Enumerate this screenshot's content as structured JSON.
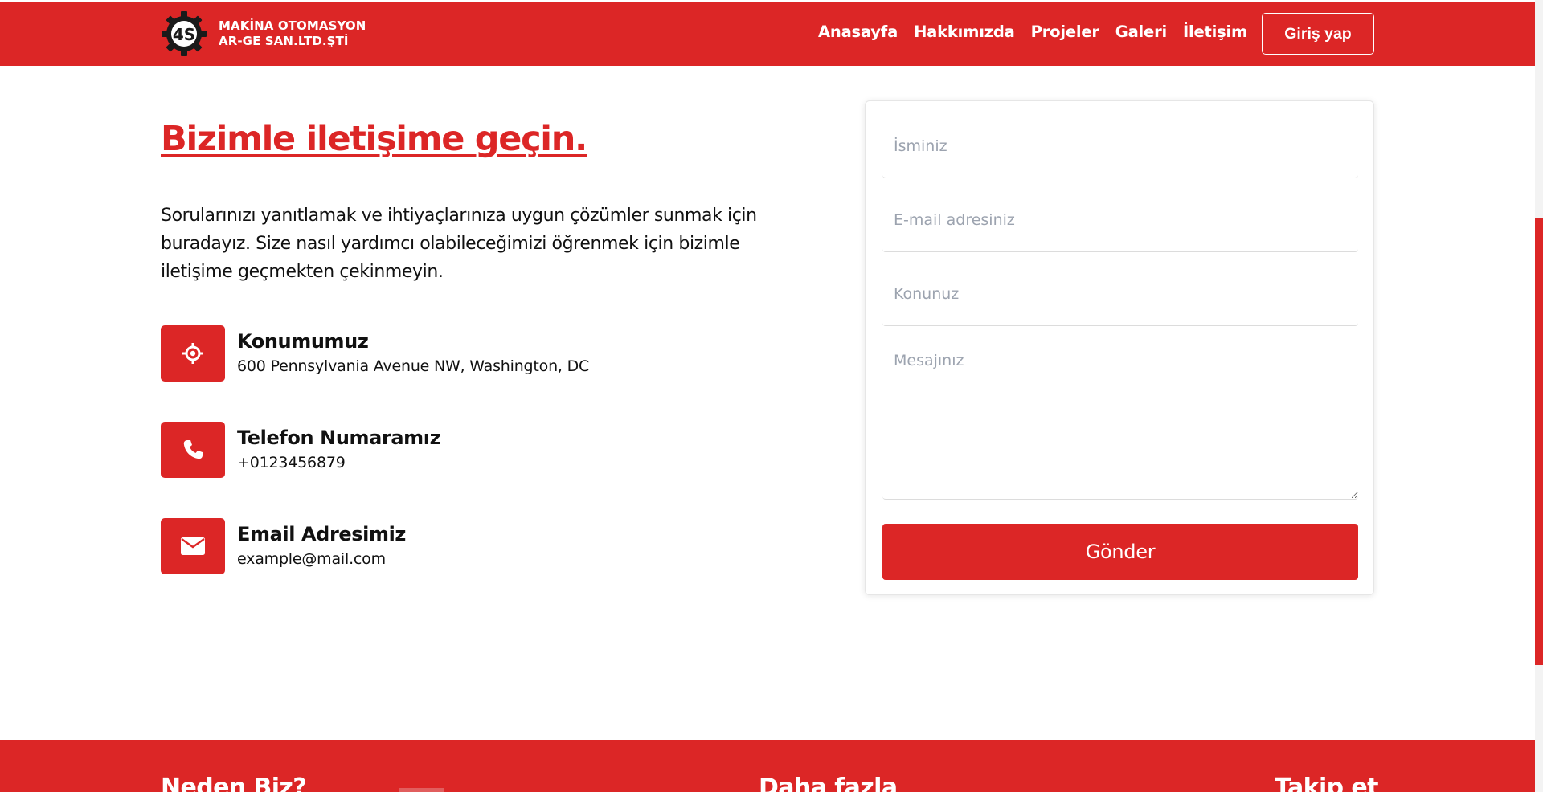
{
  "brand": {
    "name_line1": "MAKİNA OTOMASYON",
    "name_line2": "AR-GE SAN.LTD.ŞTİ",
    "logo_mark": "4S",
    "accent_color": "#dc2626"
  },
  "nav": {
    "items": [
      "Anasayfa",
      "Hakkımızda",
      "Projeler",
      "Galeri",
      "İletişim"
    ],
    "login_label": "Giriş yap"
  },
  "contact": {
    "title": "Bizimle iletişime geçin.",
    "description": "Sorularınızı yanıtlamak ve ihtiyaçlarınıza uygun çözümler sunmak için buradayız. Size nasıl yardımcı olabileceğimizi öğrenmek için bizimle iletişime geçmekten çekinmeyin.",
    "items": [
      {
        "icon": "location-crosshair-icon",
        "title": "Konumumuz",
        "value": "600 Pennsylvania Avenue NW, Washington, DC"
      },
      {
        "icon": "phone-icon",
        "title": "Telefon Numaramız",
        "value": "+0123456879"
      },
      {
        "icon": "envelope-icon",
        "title": "Email Adresimiz",
        "value": "example@mail.com"
      }
    ]
  },
  "form": {
    "name_placeholder": "İsminiz",
    "email_placeholder": "E-mail adresiniz",
    "subject_placeholder": "Konunuz",
    "message_placeholder": "Mesajınız",
    "submit_label": "Gönder"
  },
  "footer": {
    "headings": [
      "Neden Biz?",
      "Daha fazla",
      "Takip et"
    ]
  }
}
